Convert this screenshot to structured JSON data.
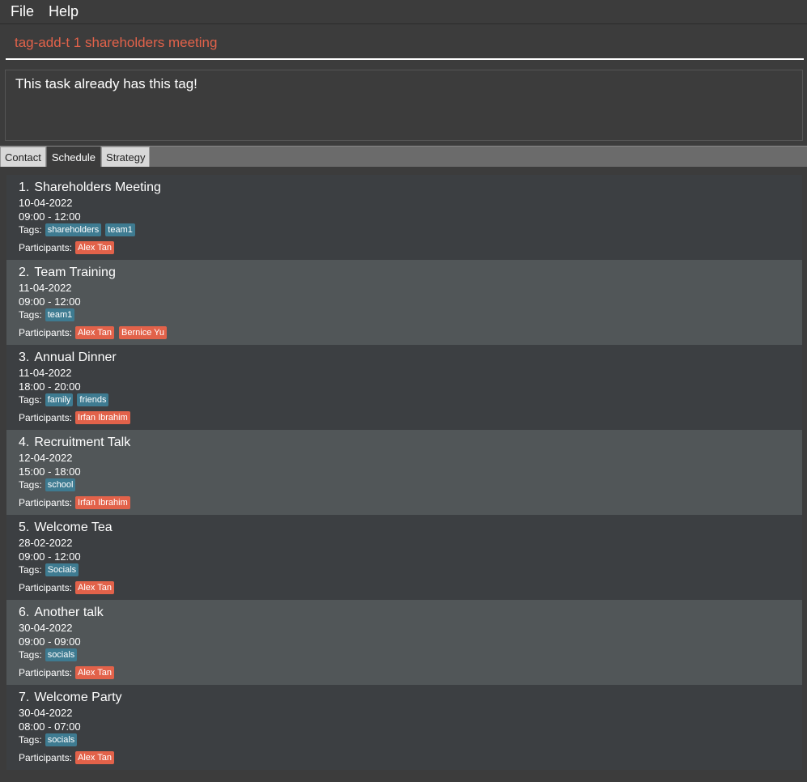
{
  "menu": {
    "file": "File",
    "help": "Help"
  },
  "command": {
    "value": "tag-add-t 1 shareholders meeting"
  },
  "result": {
    "message": "This task already has this tag!"
  },
  "tabs": [
    {
      "label": "Contact",
      "active": false
    },
    {
      "label": "Schedule",
      "active": true
    },
    {
      "label": "Strategy",
      "active": false
    }
  ],
  "labels": {
    "tags": "Tags:",
    "participants": "Participants:"
  },
  "tasks": [
    {
      "index": "1.",
      "title": "Shareholders Meeting",
      "date": "10-04-2022",
      "time": "09:00 - 12:00",
      "tags": [
        "shareholders",
        "team1"
      ],
      "participants": [
        "Alex Tan"
      ]
    },
    {
      "index": "2.",
      "title": "Team Training",
      "date": "11-04-2022",
      "time": "09:00 - 12:00",
      "tags": [
        "team1"
      ],
      "participants": [
        "Alex Tan",
        "Bernice Yu"
      ]
    },
    {
      "index": "3.",
      "title": "Annual Dinner",
      "date": "11-04-2022",
      "time": "18:00 - 20:00",
      "tags": [
        "family",
        "friends"
      ],
      "participants": [
        "Irfan Ibrahim"
      ]
    },
    {
      "index": "4.",
      "title": "Recruitment Talk",
      "date": "12-04-2022",
      "time": "15:00 - 18:00",
      "tags": [
        "school"
      ],
      "participants": [
        "Irfan Ibrahim"
      ]
    },
    {
      "index": "5.",
      "title": "Welcome Tea",
      "date": "28-02-2022",
      "time": "09:00 - 12:00",
      "tags": [
        "Socials"
      ],
      "participants": [
        "Alex Tan"
      ]
    },
    {
      "index": "6.",
      "title": "Another talk",
      "date": "30-04-2022",
      "time": "09:00 - 09:00",
      "tags": [
        "socials"
      ],
      "participants": [
        "Alex Tan"
      ]
    },
    {
      "index": "7.",
      "title": "Welcome Party",
      "date": "30-04-2022",
      "time": "08:00 - 07:00",
      "tags": [
        "socials"
      ],
      "participants": [
        "Alex Tan"
      ]
    }
  ],
  "colors": {
    "tag": "#3e7b91",
    "participant": "#e2624a",
    "command_text": "#e2624a"
  }
}
